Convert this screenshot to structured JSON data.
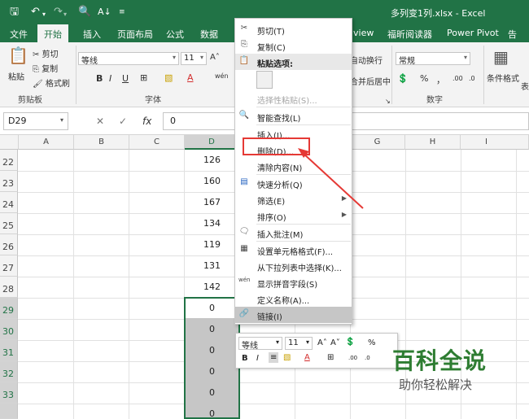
{
  "title_bar": {
    "document_title": "多列变1列.xlsx - Excel",
    "icons": [
      "save-icon",
      "undo-icon",
      "redo-icon",
      "print-preview-icon",
      "sort-icon",
      "customize-icon"
    ]
  },
  "tabs": [
    "文件",
    "开始",
    "插入",
    "页面布局",
    "公式",
    "数据",
    "view",
    "福昕阅读器",
    "Power Pivot",
    "告"
  ],
  "active_tab": "开始",
  "ribbon": {
    "clipboard": {
      "paste": "粘贴",
      "cut": "剪切",
      "copy": "复制",
      "format_painter": "格式刷",
      "group": "剪贴板"
    },
    "font": {
      "name": "等线",
      "size": "11",
      "group": "字体",
      "bold": "B",
      "italic": "I",
      "underline": "U"
    },
    "alignment": {
      "wrap": "自动换行",
      "merge": "合并后居中"
    },
    "number": {
      "format": "常规",
      "percent": "%",
      "comma": "，",
      "group": "数字"
    },
    "styles": {
      "conditional": "条件格式",
      "table": "表"
    }
  },
  "formula_bar": {
    "name_box": "D29",
    "value": "0",
    "fx": "fx"
  },
  "grid": {
    "columns": [
      "A",
      "B",
      "C",
      "D",
      "E",
      "F",
      "G",
      "H",
      "I"
    ],
    "selected_column": "D",
    "rows": [
      "22",
      "23",
      "24",
      "25",
      "26",
      "27",
      "28",
      "29",
      "30",
      "31",
      "32",
      "33"
    ],
    "selected_rows_from": "29",
    "d_values": [
      "126",
      "160",
      "167",
      "134",
      "119",
      "131",
      "142",
      "0",
      "0",
      "0",
      "0",
      "0",
      "0"
    ]
  },
  "context_menu": {
    "items": [
      {
        "label": "剪切(T)",
        "icon": "scissors-icon"
      },
      {
        "label": "复制(C)",
        "icon": "copy-icon"
      },
      {
        "label": "粘贴选项:",
        "icon": "paste-icon",
        "header": true
      },
      {
        "label": "选择性粘贴(S)...",
        "disabled": true
      },
      {
        "label": "智能查找(L)",
        "icon": "smart-lookup-icon"
      },
      {
        "label": "插入(I)..."
      },
      {
        "label": "删除(D)...",
        "highlighted": true
      },
      {
        "label": "清除内容(N)"
      },
      {
        "label": "快速分析(Q)",
        "icon": "quick-analysis-icon"
      },
      {
        "label": "筛选(E)",
        "submenu": true
      },
      {
        "label": "排序(O)",
        "submenu": true
      },
      {
        "label": "插入批注(M)",
        "icon": "comment-icon"
      },
      {
        "label": "设置单元格格式(F)...",
        "icon": "format-cells-icon"
      },
      {
        "label": "从下拉列表中选择(K)..."
      },
      {
        "label": "显示拼音字段(S)",
        "icon": "phonetic-icon"
      },
      {
        "label": "定义名称(A)..."
      },
      {
        "label": "链接(I)",
        "icon": "link-icon",
        "hover": true
      }
    ]
  },
  "mini_toolbar": {
    "font": "等线",
    "size": "11",
    "percent": "%",
    "bold": "B",
    "italic": "I"
  },
  "watermark": {
    "main": "百科全说",
    "sub": "助你轻松解决"
  },
  "colors": {
    "excel_green": "#217346",
    "annotation_red": "#e53935",
    "watermark_green": "#2e7d32"
  }
}
